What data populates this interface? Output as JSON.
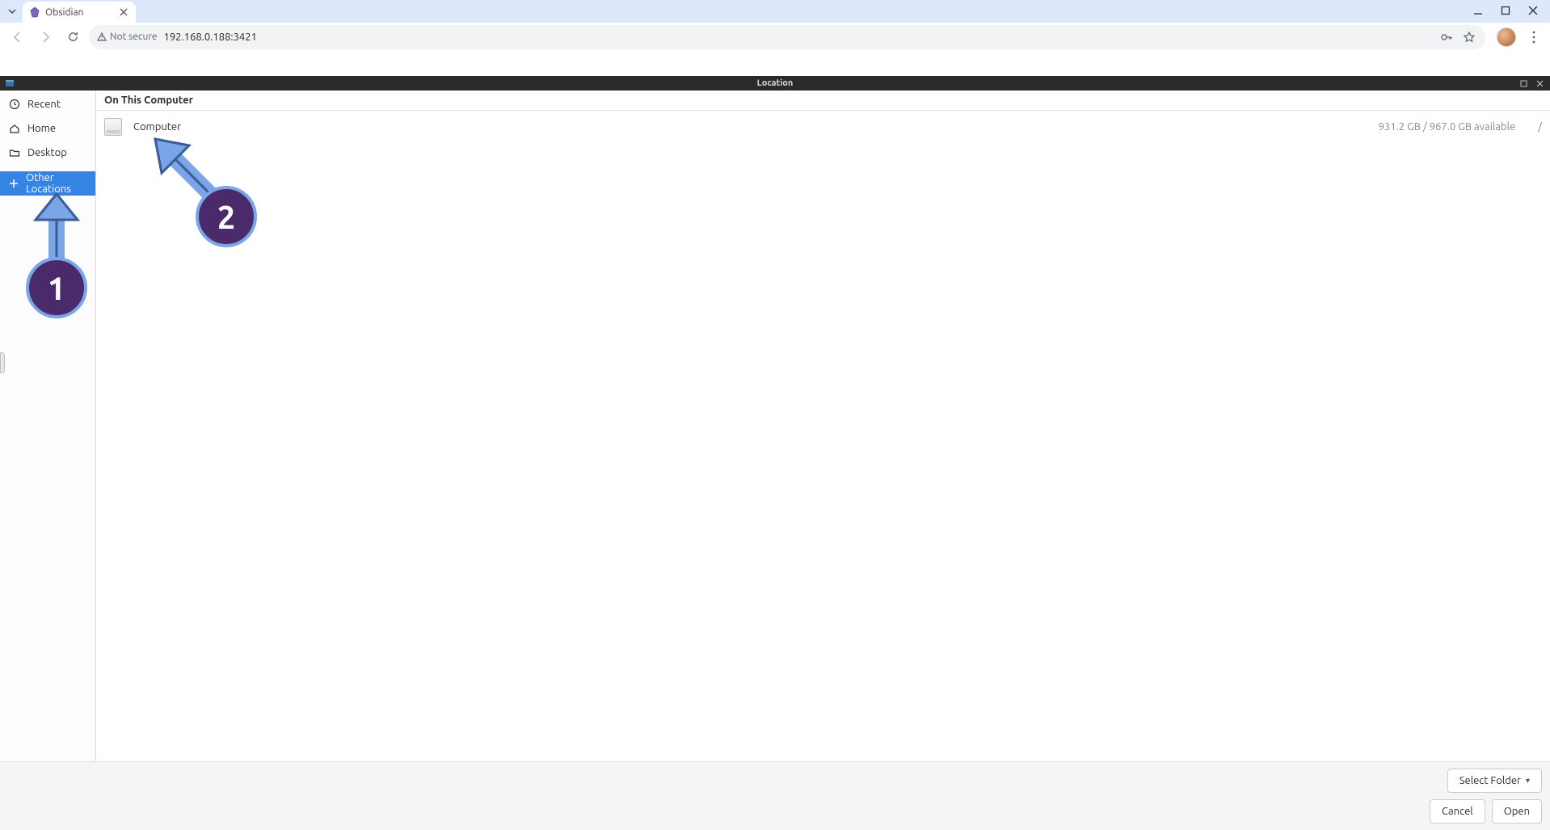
{
  "browser": {
    "tab_title": "Obsidian",
    "not_secure": "Not secure",
    "url": "192.168.0.188:3421"
  },
  "dialog": {
    "title": "Location",
    "sidebar": {
      "items": [
        {
          "label": "Recent"
        },
        {
          "label": "Home"
        },
        {
          "label": "Desktop"
        },
        {
          "label": "Other Locations"
        }
      ]
    },
    "main": {
      "header": "On This Computer",
      "volume": {
        "name": "Computer",
        "info": "931.2 GB / 967.0 GB available",
        "path": "/"
      }
    },
    "footer": {
      "select_folder": "Select Folder",
      "cancel": "Cancel",
      "open": "Open"
    }
  },
  "annotations": {
    "one": "1",
    "two": "2"
  }
}
